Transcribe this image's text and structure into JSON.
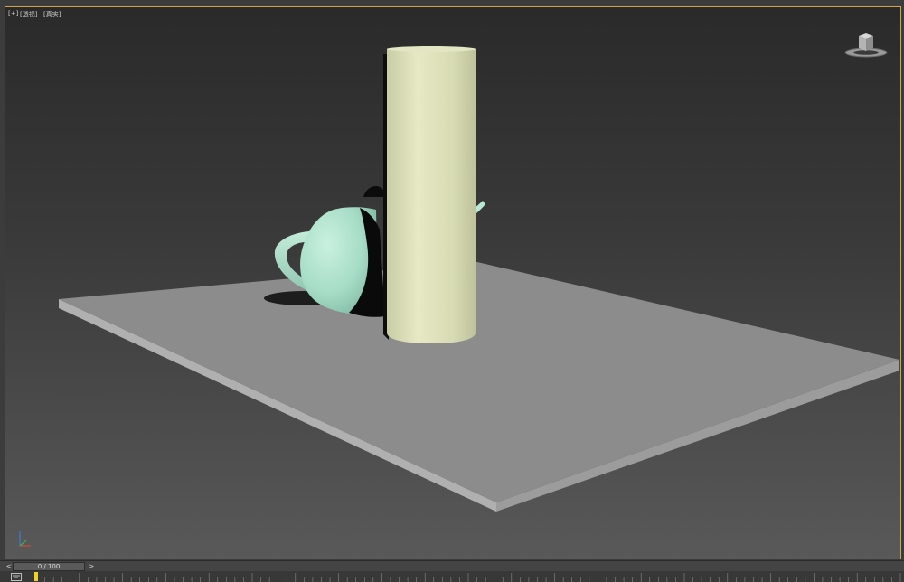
{
  "viewport": {
    "labels": [
      "[+]",
      "[透视]",
      "[真实]"
    ]
  },
  "scene": {
    "objects": [
      "plane",
      "teapot",
      "cylinder"
    ],
    "colors": {
      "plane_top": "#8c8c8c",
      "plane_side": "#a8a8a8",
      "teapot": "#a9dfc9",
      "cylinder": "#dfe3bc",
      "border_active": "#d4a64a",
      "time_marker": "#f2d02a"
    }
  },
  "icons": {
    "viewcube": "viewcube-icon",
    "axis": "axis-tripod-icon",
    "trackbar_toggle": "curve-editor-icon"
  },
  "timeslider": {
    "prev": "<",
    "next": ">",
    "frame_display": "0 / 100",
    "current_frame": 0,
    "total_frames": 100
  }
}
